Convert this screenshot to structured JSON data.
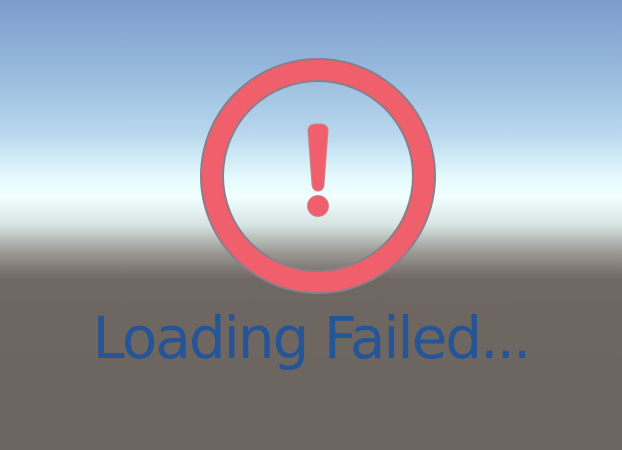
{
  "status": {
    "icon": "exclamation-circle-icon",
    "message": "Loading Failed..."
  },
  "colors": {
    "icon_red": "#f0606c",
    "icon_stroke": "#8b7e8a",
    "message_blue": "#255497"
  }
}
